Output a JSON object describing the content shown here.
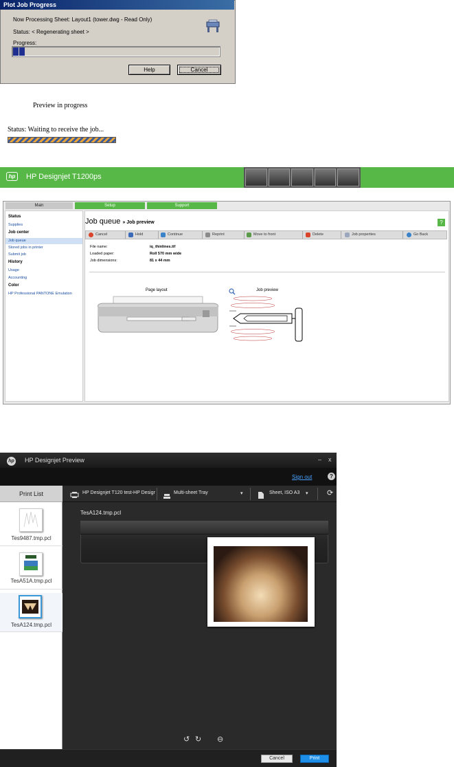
{
  "plot_dialog": {
    "title": "Plot Job Progress",
    "processing_line": "Now Processing Sheet: Layout1 (tower.dwg - Read Only)",
    "status_line": "Status: < Regenerating sheet >",
    "progress_label": "Progress:",
    "progress_fraction": 0.05,
    "help_button": "Help",
    "cancel_button": "Cancel"
  },
  "preview_status": {
    "preview_text": "Preview in progress",
    "status_text": "Status: Waiting to receive the job..."
  },
  "ews": {
    "product_title": "HP Designjet T1200ps",
    "logo_text": "hp",
    "tabs": [
      "Main",
      "Setup",
      "Support"
    ],
    "sidebar": {
      "status_heading": "Status",
      "supplies": "Supplies",
      "job_center_heading": "Job center",
      "job_queue": "Job queue",
      "stored_jobs": "Stored jobs in printer",
      "submit_job": "Submit job",
      "history_heading": "History",
      "usage": "Usage",
      "accounting": "Accounting",
      "color_heading": "Color",
      "pantone": "HP Professional PANTONE Emulation"
    },
    "page_title": "Job queue",
    "page_subtitle": "» Job preview",
    "help_icon_text": "?",
    "toolbar": [
      "Cancel",
      "Hold",
      "Continue",
      "Reprint",
      "Move to front",
      "Delete",
      "Job properties",
      "Go Back"
    ],
    "info": {
      "file_name_label": "File name:",
      "file_name_value": "iq_thinlines.tif",
      "loaded_paper_label": "Loaded paper:",
      "loaded_paper_value": "Roll   570 mm wide",
      "job_dimensions_label": "Job dimensions:",
      "job_dimensions_value": "81 x 44 mm"
    },
    "page_layout_caption": "Page layout",
    "job_preview_caption": "Job preview"
  },
  "app": {
    "title": "HP Designjet Preview",
    "logo_text": "hp",
    "minimize": "–",
    "close": "x",
    "sign_out": "Sign out",
    "help": "?",
    "print_list_header": "Print List",
    "print_list": [
      {
        "label": "Tes9487.tmp.pcl"
      },
      {
        "label": "TesA51A.tmp.pcl"
      },
      {
        "label": "TesA124.tmp.pcl"
      }
    ],
    "printer_select": "HP Designjet T120 test-HP Desigr",
    "tray_select": "Multi-sheet Tray",
    "paper_select": "Sheet, ISO A3",
    "current_file": "TesA124.tmp.pcl",
    "cancel_button": "Cancel",
    "print_button": "Print",
    "colors": {
      "accent": "#1e8fe8",
      "link": "#4aa3ff",
      "hp_green": "#57b847"
    }
  }
}
